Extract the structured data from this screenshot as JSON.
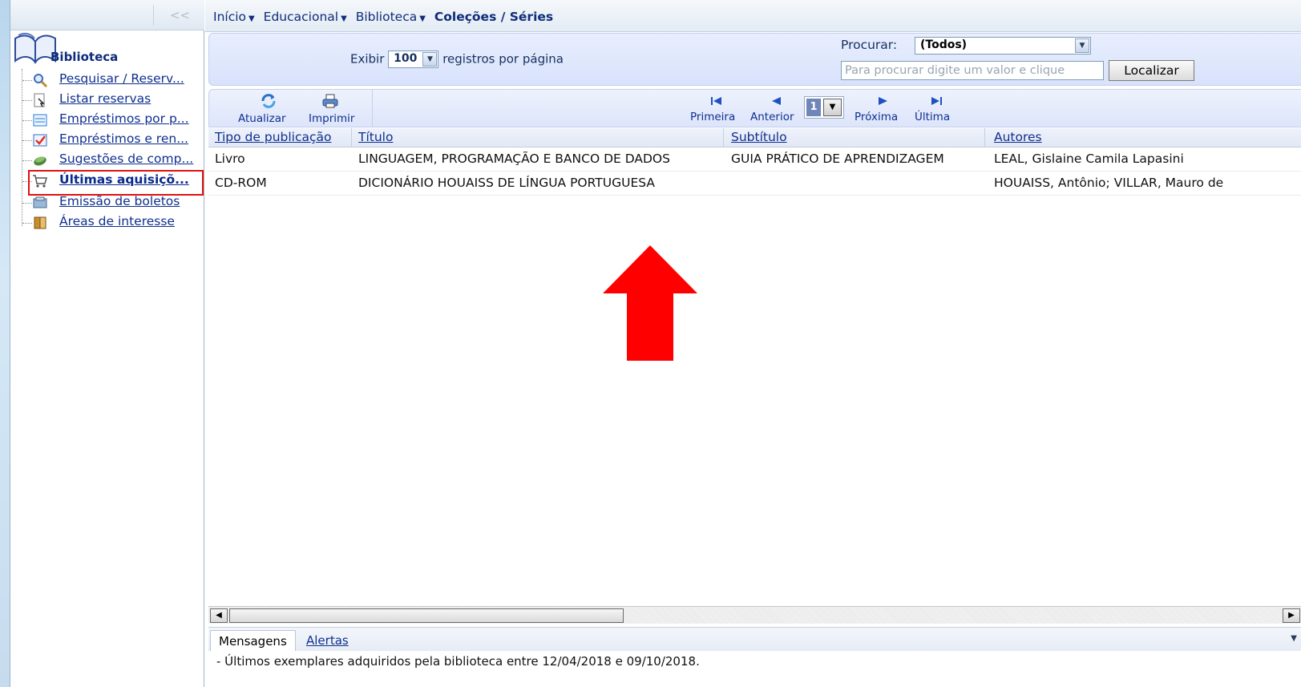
{
  "sidebar": {
    "collapse_label": "<<",
    "title": "Biblioteca",
    "items": [
      {
        "label": "Pesquisar / Reserv...",
        "icon": "search-icon"
      },
      {
        "label": "Listar reservas",
        "icon": "reservation-icon"
      },
      {
        "label": "Empréstimos por p...",
        "icon": "loan-list-icon"
      },
      {
        "label": "Empréstimos e ren...",
        "icon": "loan-renew-icon"
      },
      {
        "label": "Sugestões de comp...",
        "icon": "suggestion-icon"
      },
      {
        "label": "Últimas aquisiçõ...",
        "icon": "cart-icon",
        "active": true
      },
      {
        "label": "Emissão de boletos",
        "icon": "boleto-icon"
      },
      {
        "label": "Áreas de interesse",
        "icon": "book-area-icon"
      }
    ]
  },
  "breadcrumb": {
    "items": [
      "Início",
      "Educacional",
      "Biblioteca"
    ],
    "current": "Coleções / Séries"
  },
  "toolbar": {
    "exibir_label": "Exibir",
    "per_page_value": "100",
    "per_page_suffix": "registros por página",
    "procurar_label": "Procurar:",
    "procurar_value": "(Todos)",
    "search_placeholder": "Para procurar digite um valor e clique",
    "localizar_label": "Localizar"
  },
  "nav": {
    "atualizar_label": "Atualizar",
    "imprimir_label": "Imprimir",
    "primeira_label": "Primeira",
    "anterior_label": "Anterior",
    "page_value": "1",
    "proxima_label": "Próxima",
    "ultima_label": "Última"
  },
  "table": {
    "headers": [
      "Tipo de publicação",
      "Título",
      "Subtítulo",
      "Autores"
    ],
    "rows": [
      [
        "Livro",
        "LINGUAGEM, PROGRAMAÇÃO E BANCO DE DADOS",
        "GUIA PRÁTICO DE APRENDIZAGEM",
        "LEAL, Gislaine Camila Lapasini"
      ],
      [
        "CD-ROM",
        "DICIONÁRIO HOUAISS DE LÍNGUA PORTUGUESA",
        "",
        "HOUAISS, Antônio; VILLAR, Mauro de"
      ]
    ]
  },
  "bottom": {
    "tab_messages": "Mensagens",
    "tab_alerts": "Alertas",
    "message": "- Últimos exemplares adquiridos pela biblioteca entre 12/04/2018 e 09/10/2018."
  },
  "colors": {
    "accent_link": "#0e2f8f",
    "highlight_box": "#e01010",
    "arrow": "#ff0000"
  }
}
